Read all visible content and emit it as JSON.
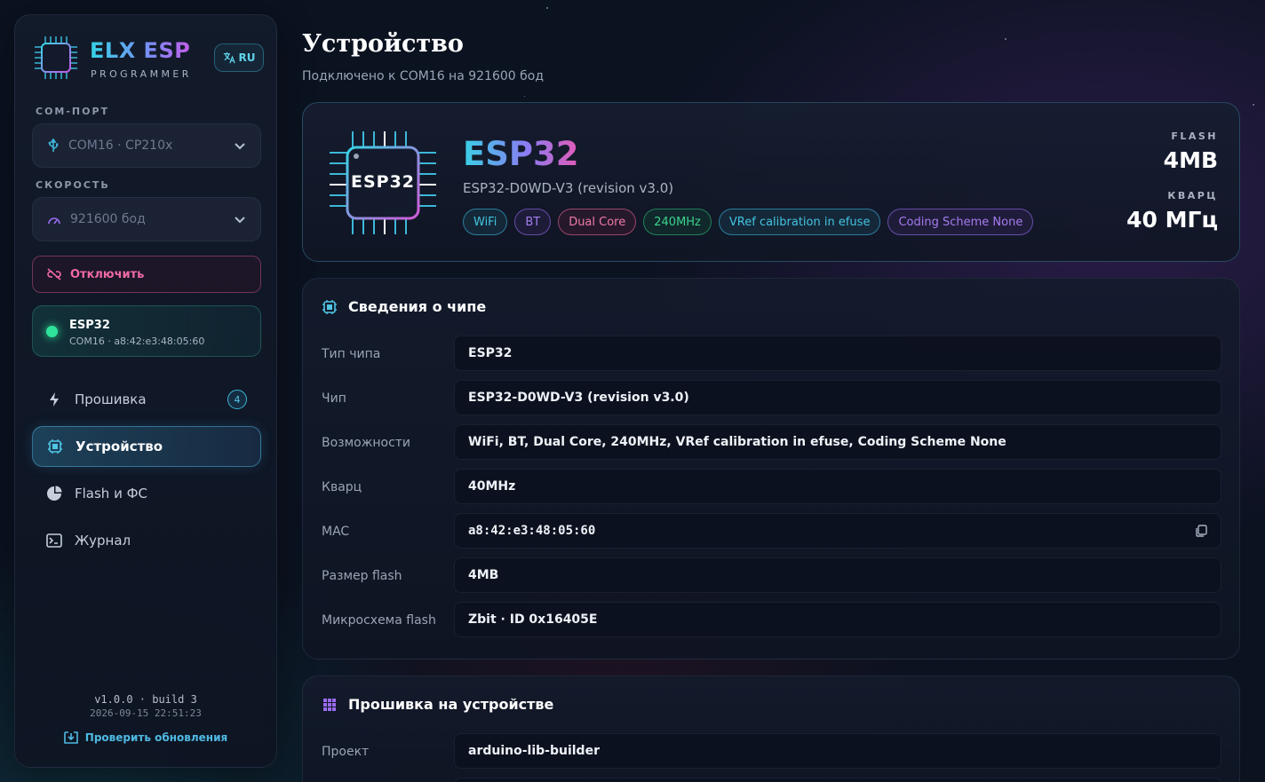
{
  "sidebar": {
    "brand_title": "ELX ESP",
    "brand_sub": "PROGRAMMER",
    "lang": "RU",
    "com_label": "COM-ПОРТ",
    "com_value": "COM16 · CP210x",
    "speed_label": "СКОРОСТЬ",
    "speed_value": "921600 бод",
    "disconnect": "Отключить",
    "device": {
      "name": "ESP32",
      "sub": "COM16 · a8:42:e3:48:05:60"
    },
    "nav": [
      {
        "label": "Прошивка",
        "badge": "4"
      },
      {
        "label": "Устройство"
      },
      {
        "label": "Flash и ФС"
      },
      {
        "label": "Журнал"
      }
    ],
    "version": "v1.0.0 · build 3",
    "build_date": "2026-09-15 22:51:23",
    "update": "Проверить обновления"
  },
  "header": {
    "title": "Устройство",
    "subtitle": "Подключено к COM16 на 921600 бод"
  },
  "hero": {
    "chip_label": "ESP32",
    "name": "ESP32",
    "desc": "ESP32-D0WD-V3 (revision v3.0)",
    "tags": [
      "WiFi",
      "BT",
      "Dual Core",
      "240MHz",
      "VRef calibration in efuse",
      "Coding Scheme None"
    ],
    "flash_label": "FLASH",
    "flash_value": "4MB",
    "crystal_label": "КВАРЦ",
    "crystal_value": "40 МГц"
  },
  "chip_info": {
    "title": "Сведения о чипе",
    "rows": [
      {
        "label": "Тип чипа",
        "value": "ESP32"
      },
      {
        "label": "Чип",
        "value": "ESP32-D0WD-V3 (revision v3.0)"
      },
      {
        "label": "Возможности",
        "value": "WiFi, BT, Dual Core, 240MHz, VRef calibration in efuse, Coding Scheme None"
      },
      {
        "label": "Кварц",
        "value": "40MHz"
      },
      {
        "label": "MAC",
        "value": "a8:42:e3:48:05:60"
      },
      {
        "label": "Размер flash",
        "value": "4MB"
      },
      {
        "label": "Микросхема flash",
        "value": "Zbit · ID 0x16405E"
      }
    ]
  },
  "firmware": {
    "title": "Прошивка на устройстве",
    "rows": [
      {
        "label": "Проект",
        "value": "arduino-lib-builder"
      }
    ]
  },
  "colors": {
    "accent": "#3db4d8",
    "danger": "#f06aa5",
    "online": "#2ee39a"
  }
}
